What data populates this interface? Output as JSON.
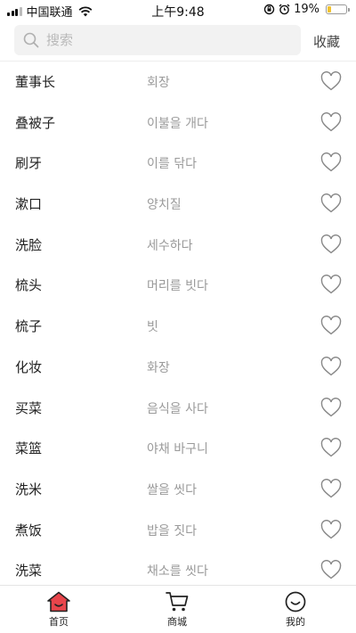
{
  "status_bar": {
    "carrier": "中国联通",
    "time": "上午9:48",
    "battery": "19%",
    "battery_level": 0.19
  },
  "search": {
    "placeholder": "搜索",
    "collect_label": "收藏"
  },
  "words": [
    {
      "cn": "董事长",
      "kr": "회장"
    },
    {
      "cn": "叠被子",
      "kr": "이불을 개다"
    },
    {
      "cn": "刷牙",
      "kr": "이를 닦다"
    },
    {
      "cn": "漱口",
      "kr": "양치질"
    },
    {
      "cn": "洗脸",
      "kr": "세수하다"
    },
    {
      "cn": "梳头",
      "kr": "머리를 빗다"
    },
    {
      "cn": "梳子",
      "kr": "빗"
    },
    {
      "cn": "化妆",
      "kr": "화장"
    },
    {
      "cn": "买菜",
      "kr": "음식을 사다"
    },
    {
      "cn": "菜篮",
      "kr": "야채 바구니"
    },
    {
      "cn": "洗米",
      "kr": "쌀을 씻다"
    },
    {
      "cn": "煮饭",
      "kr": "밥을 짓다"
    },
    {
      "cn": "洗菜",
      "kr": "채소를 씻다"
    }
  ],
  "tabs": {
    "home": "首页",
    "mall": "商城",
    "mine": "我的"
  },
  "colors": {
    "accent": "#e8454b",
    "heart_outline": "#888888"
  }
}
